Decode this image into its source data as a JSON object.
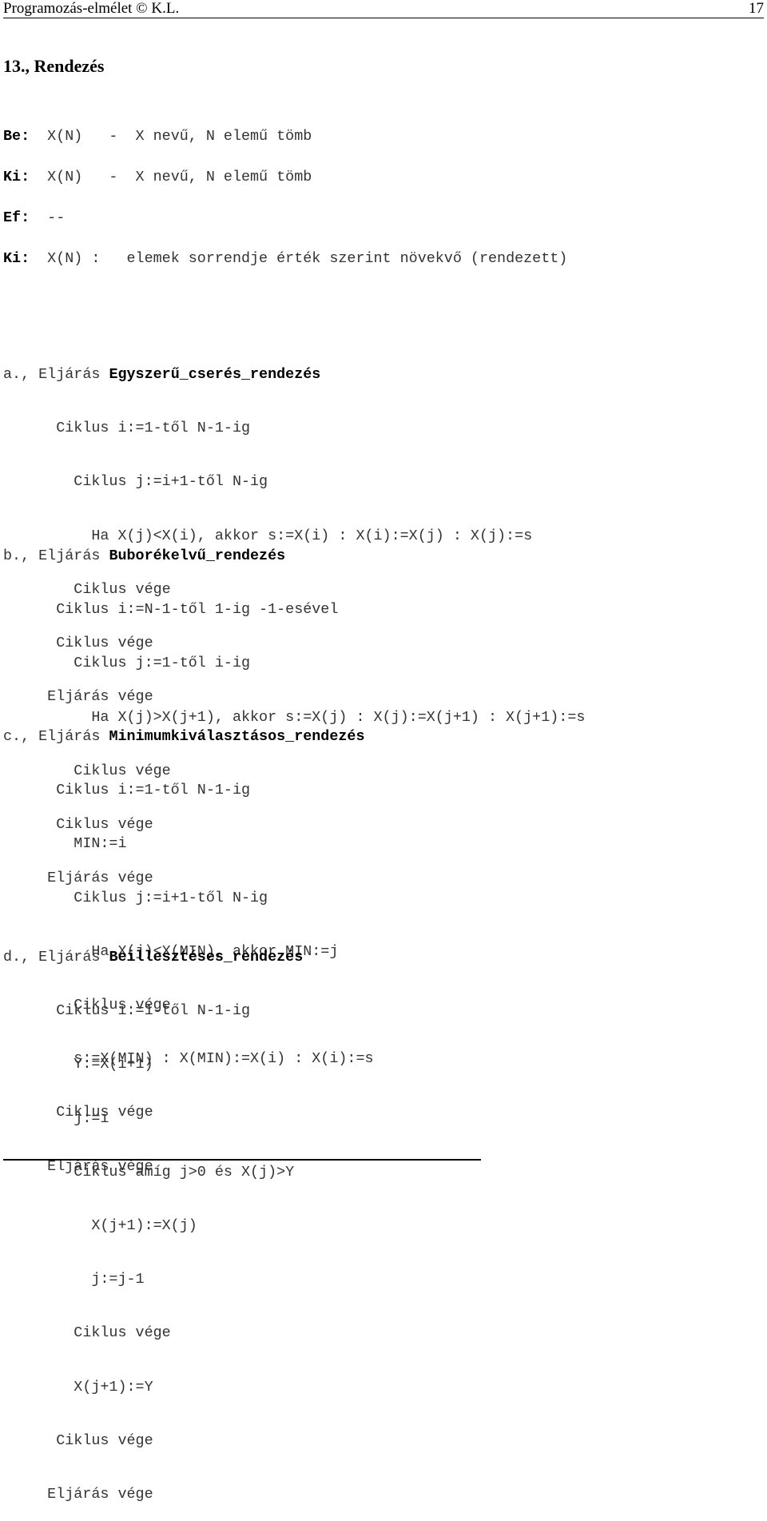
{
  "header": {
    "left": "Programozás-elmélet   © K.L.",
    "page_number": "17"
  },
  "title": "13., Rendezés",
  "io": [
    {
      "label": "Be:",
      "text": "  X(N)   -  X nevű, N elemű tömb"
    },
    {
      "label": "Ki:",
      "text": "  X(N)   -  X nevű, N elemű tömb"
    },
    {
      "label": "Ef:",
      "text": "  --"
    },
    {
      "label": "Ki:",
      "text": "  X(N) :   elemek sorrendje érték szerint növekvő (rendezett)"
    }
  ],
  "sections": [
    {
      "prefix": "a., Eljárás ",
      "name": "Egyszerű_cserés_rendezés",
      "lines": [
        "      Ciklus i:=1-től N-1-ig",
        "        Ciklus j:=i+1-től N-ig",
        "          Ha X(j)<X(i), akkor s:=X(i) : X(i):=X(j) : X(j):=s",
        "        Ciklus vége",
        "      Ciklus vége",
        "     Eljárás vége"
      ]
    },
    {
      "prefix": "b., Eljárás ",
      "name": "Buborékelvű_rendezés",
      "lines": [
        "      Ciklus i:=N-1-től 1-ig -1-esével",
        "        Ciklus j:=1-től i-ig",
        "          Ha X(j)>X(j+1), akkor s:=X(j) : X(j):=X(j+1) : X(j+1):=s",
        "        Ciklus vége",
        "      Ciklus vége",
        "     Eljárás vége"
      ]
    },
    {
      "prefix": "c., Eljárás ",
      "name": "Minimumkiválasztásos_rendezés",
      "lines": [
        "      Ciklus i:=1-től N-1-ig",
        "        MIN:=i",
        "        Ciklus j:=i+1-től N-ig",
        "          Ha X(j)<X(MIN), akkor MIN:=j",
        "        Ciklus vége",
        "        s:=X(MIN) : X(MIN):=X(i) : X(i):=s",
        "      Ciklus vége",
        "     Eljárás vége"
      ]
    },
    {
      "prefix": "d., Eljárás ",
      "name": "Beillesztéses_rendezés",
      "lines": [
        "      Ciklus i:=1-től N-1-ig",
        "        Y:=X(i+1)",
        "        j:=i",
        "        Ciklus amíg j>0 és X(j)>Y",
        "          X(j+1):=X(j)",
        "          j:=j-1",
        "        Ciklus vége",
        "        X(j+1):=Y",
        "      Ciklus vége",
        "     Eljárás vége"
      ]
    }
  ]
}
